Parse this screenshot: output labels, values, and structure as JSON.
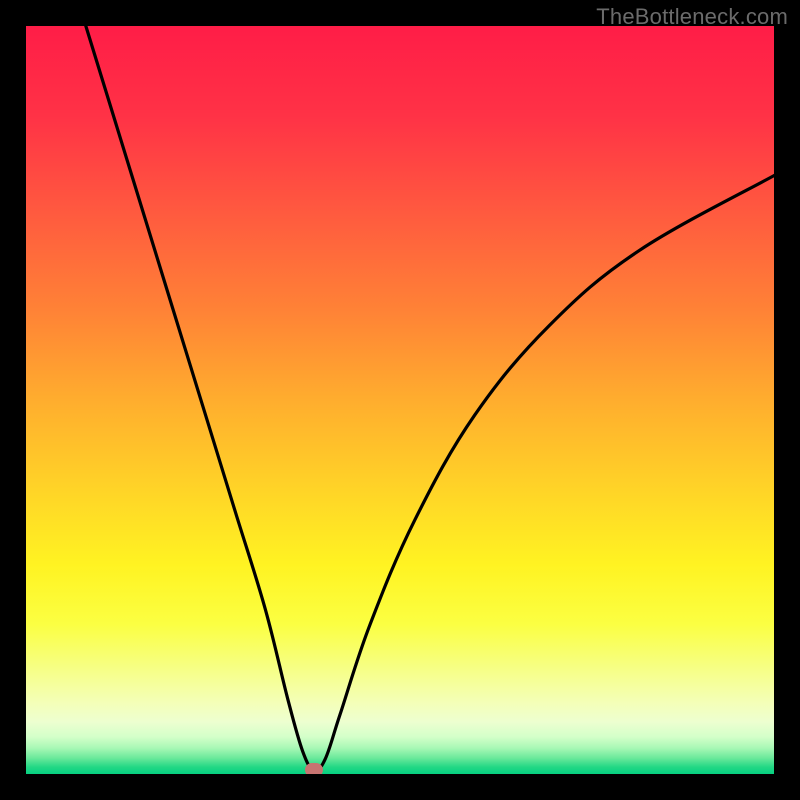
{
  "watermark": "TheBottleneck.com",
  "chart_data": {
    "type": "line",
    "title": "",
    "xlabel": "",
    "ylabel": "",
    "xlim": [
      0,
      100
    ],
    "ylim": [
      0,
      100
    ],
    "series": [
      {
        "name": "bottleneck-curve",
        "x": [
          8,
          12,
          16,
          20,
          24,
          28,
          32,
          35,
          37,
          38.5,
          40,
          42,
          46,
          52,
          60,
          70,
          82,
          100
        ],
        "values": [
          100,
          87,
          74,
          61,
          48,
          35,
          22,
          10,
          3,
          0.5,
          2,
          8,
          20,
          34,
          48,
          60,
          70,
          80
        ]
      }
    ],
    "annotations": [
      {
        "name": "optimal-marker",
        "x": 38.5,
        "y": 0.5
      }
    ],
    "background_gradient_stops": [
      {
        "pos": 0.0,
        "color": "#ff1d47"
      },
      {
        "pos": 0.12,
        "color": "#ff3246"
      },
      {
        "pos": 0.25,
        "color": "#ff5a3f"
      },
      {
        "pos": 0.38,
        "color": "#ff8236"
      },
      {
        "pos": 0.5,
        "color": "#ffad2e"
      },
      {
        "pos": 0.62,
        "color": "#ffd427"
      },
      {
        "pos": 0.72,
        "color": "#fff322"
      },
      {
        "pos": 0.8,
        "color": "#fbff42"
      },
      {
        "pos": 0.86,
        "color": "#f6ff86"
      },
      {
        "pos": 0.905,
        "color": "#f4ffb8"
      },
      {
        "pos": 0.93,
        "color": "#edffd0"
      },
      {
        "pos": 0.95,
        "color": "#d3ffc9"
      },
      {
        "pos": 0.965,
        "color": "#a8f8b5"
      },
      {
        "pos": 0.978,
        "color": "#6be99b"
      },
      {
        "pos": 0.99,
        "color": "#23d885"
      },
      {
        "pos": 1.0,
        "color": "#06d181"
      }
    ]
  }
}
